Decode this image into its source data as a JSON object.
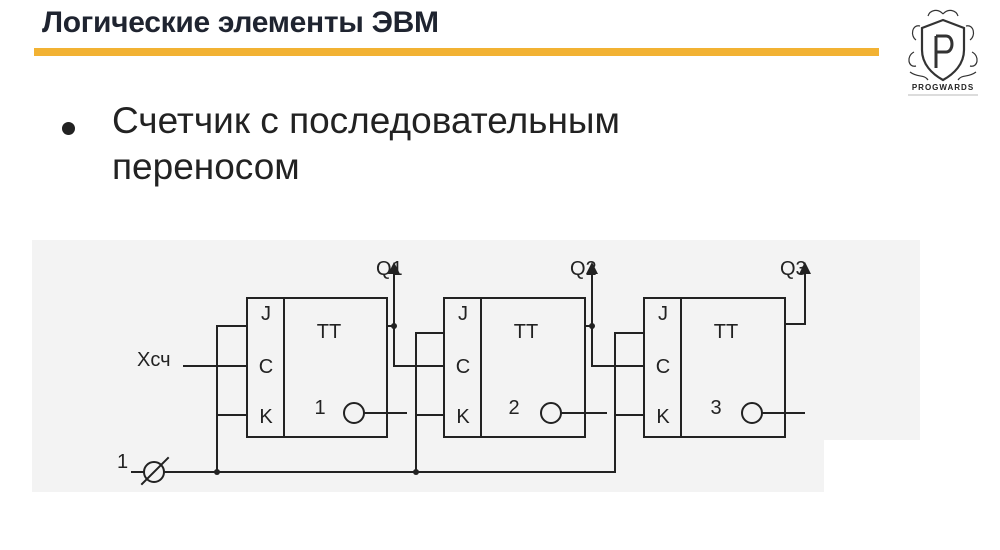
{
  "header": {
    "title": "Логические элементы ЭВМ"
  },
  "logo": {
    "name": "PROGWARDS",
    "icon": "shield-p-logo",
    "accent": "#f2b233"
  },
  "bullet": {
    "line1": "Счетчик с последовательным",
    "line2": "переносом"
  },
  "diagram": {
    "input_label": "Xсч",
    "constant_label": "1",
    "flipflops": [
      {
        "j": "J",
        "c": "C",
        "k": "K",
        "type": "TT",
        "index": "1",
        "output": "Q1"
      },
      {
        "j": "J",
        "c": "C",
        "k": "K",
        "type": "TT",
        "index": "2",
        "output": "Q2"
      },
      {
        "j": "J",
        "c": "C",
        "k": "K",
        "type": "TT",
        "index": "3",
        "output": "Q3"
      }
    ]
  }
}
